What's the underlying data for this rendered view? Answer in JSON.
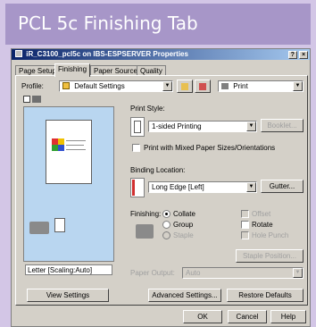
{
  "caption": "PCL 5c Finishing Tab",
  "window": {
    "title": "iR_C3100_pcl5c on IBS-ESPSERVER Properties",
    "help_btn": "?",
    "close_btn": "×"
  },
  "tabs": [
    {
      "label": "Page Setup"
    },
    {
      "label": "Finishing"
    },
    {
      "label": "Paper Source"
    },
    {
      "label": "Quality"
    }
  ],
  "profile": {
    "label": "Profile:",
    "value": "Default Settings",
    "output_value": "Print"
  },
  "preview": {
    "caption": "Letter [Scaling:Auto]",
    "view_settings": "View Settings"
  },
  "print_style": {
    "label": "Print Style:",
    "value": "1-sided Printing",
    "booklet_btn": "Booklet...",
    "mixed_label": "Print with Mixed Paper Sizes/Orientations"
  },
  "binding": {
    "label": "Binding Location:",
    "value": "Long Edge [Left]",
    "gutter_btn": "Gutter..."
  },
  "finishing": {
    "label": "Finishing:",
    "collate": "Collate",
    "group": "Group",
    "staple": "Staple",
    "offset": "Offset",
    "rotate": "Rotate",
    "hole_punch": "Hole Punch",
    "staple_position_btn": "Staple Position..."
  },
  "paper_output": {
    "label": "Paper Output:",
    "value": "Auto"
  },
  "footer": {
    "advanced": "Advanced Settings...",
    "restore": "Restore Defaults",
    "ok": "OK",
    "cancel": "Cancel",
    "help": "Help"
  }
}
